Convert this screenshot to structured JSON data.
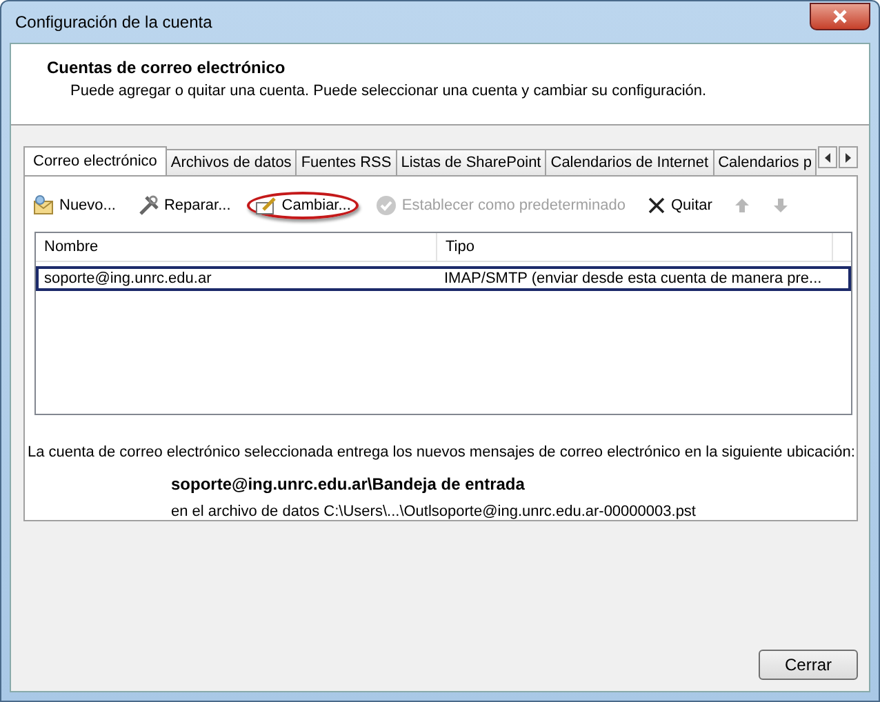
{
  "window": {
    "title": "Configuración de la cuenta"
  },
  "header": {
    "title": "Cuentas de correo electrónico",
    "subtitle": "Puede agregar o quitar una cuenta. Puede seleccionar una cuenta y cambiar su configuración."
  },
  "tabs": [
    {
      "label": "Correo electrónico",
      "selected": true
    },
    {
      "label": "Archivos de datos",
      "selected": false
    },
    {
      "label": "Fuentes RSS",
      "selected": false
    },
    {
      "label": "Listas de SharePoint",
      "selected": false
    },
    {
      "label": "Calendarios de Internet",
      "selected": false
    },
    {
      "label": "Calendarios p",
      "selected": false
    }
  ],
  "toolbar": [
    {
      "kind": "new",
      "label": "Nuevo...",
      "disabled": false,
      "highlighted": false
    },
    {
      "kind": "repair",
      "label": "Reparar...",
      "disabled": false,
      "highlighted": false
    },
    {
      "kind": "change",
      "label": "Cambiar...",
      "disabled": false,
      "highlighted": true
    },
    {
      "kind": "default",
      "label": "Establecer como predeterminado",
      "disabled": true,
      "highlighted": false
    },
    {
      "kind": "remove",
      "label": "Quitar",
      "disabled": false,
      "highlighted": false
    },
    {
      "kind": "up",
      "disabled": true,
      "highlighted": false
    },
    {
      "kind": "down",
      "disabled": true,
      "highlighted": false
    }
  ],
  "table": {
    "columns": [
      "Nombre",
      "Tipo"
    ],
    "rows": [
      {
        "cells": [
          "soporte@ing.unrc.edu.ar",
          "IMAP/SMTP (enviar desde esta cuenta de manera pre..."
        ],
        "selected": true
      }
    ]
  },
  "delivery": {
    "intro": "La cuenta de correo electrónico seleccionada entrega los nuevos mensajes de correo electrónico en la siguiente ubicación:",
    "folder": "soporte@ing.unrc.edu.ar\\Bandeja de entrada",
    "file": "en el archivo de datos C:\\Users\\...\\Outlsoporte@ing.unrc.edu.ar-00000003.pst"
  },
  "buttons": [
    "Cerrar"
  ]
}
